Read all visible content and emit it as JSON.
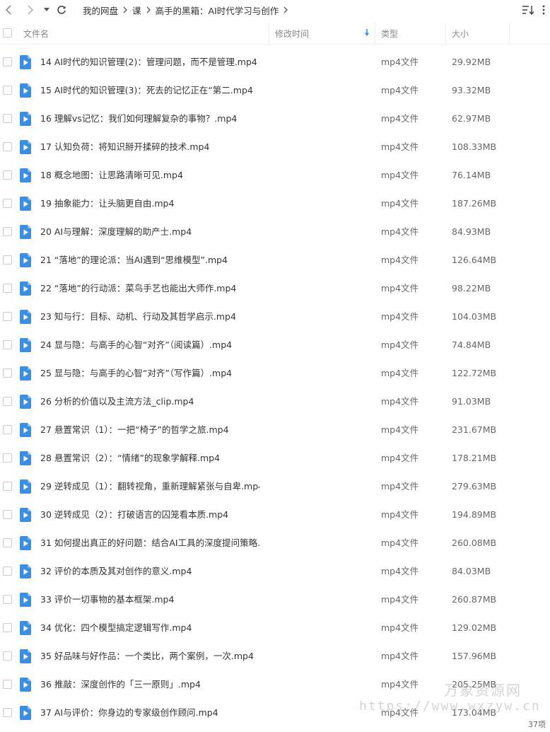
{
  "toolbar": {
    "breadcrumb": [
      "我的网盘",
      "课",
      "高手的黑箱：AI时代学习与创作"
    ]
  },
  "header": {
    "name": "文件名",
    "modified": "修改时间",
    "type": "类型",
    "size": "大小"
  },
  "files": [
    {
      "name": "14 AI时代的知识管理(2)：管理问题，而不是管理.mp4",
      "type": "mp4文件",
      "size": "29.92MB"
    },
    {
      "name": "15 AI时代的知识管理(3)：死去的记忆正在“第二.mp4",
      "type": "mp4文件",
      "size": "93.32MB"
    },
    {
      "name": "16 理解vs记忆：我们如何理解复杂的事物？.mp4",
      "type": "mp4文件",
      "size": "62.97MB"
    },
    {
      "name": "17 认知负荷：将知识掰开揉碎的技术.mp4",
      "type": "mp4文件",
      "size": "108.33MB"
    },
    {
      "name": "18 概念地图：让思路清晰可见.mp4",
      "type": "mp4文件",
      "size": "76.14MB"
    },
    {
      "name": "19 抽象能力：让头脑更自由.mp4",
      "type": "mp4文件",
      "size": "187.26MB"
    },
    {
      "name": "20 AI与理解：深度理解的助产士.mp4",
      "type": "mp4文件",
      "size": "84.93MB"
    },
    {
      "name": "21 “落地”的理论派：当AI遇到“思维模型”.mp4",
      "type": "mp4文件",
      "size": "126.64MB"
    },
    {
      "name": "22 “落地”的行动派：菜鸟手艺也能出大师作.mp4",
      "type": "mp4文件",
      "size": "98.22MB"
    },
    {
      "name": "23 知与行：目标、动机、行动及其哲学启示.mp4",
      "type": "mp4文件",
      "size": "104.03MB"
    },
    {
      "name": "24 显与隐：与高手的心智“对齐”（阅读篇）.mp4",
      "type": "mp4文件",
      "size": "74.84MB"
    },
    {
      "name": "25 显与隐：与高手的心智“对齐”（写作篇）.mp4",
      "type": "mp4文件",
      "size": "122.72MB"
    },
    {
      "name": "26 分析的价值以及主流方法_clip.mp4",
      "type": "mp4文件",
      "size": "91.03MB"
    },
    {
      "name": "27 悬置常识（1）：一把“椅子”的哲学之旅.mp4",
      "type": "mp4文件",
      "size": "231.67MB"
    },
    {
      "name": "28 悬置常识（2）：“情绪”的现象学解释.mp4",
      "type": "mp4文件",
      "size": "178.21MB"
    },
    {
      "name": "29 逆转成见（1）：翻转视角，重新理解紧张与自卑.mp4",
      "type": "mp4文件",
      "size": "279.63MB"
    },
    {
      "name": "30 逆转成见（2）：打破语言的囚笼看本质.mp4",
      "type": "mp4文件",
      "size": "194.89MB"
    },
    {
      "name": "31 如何提出真正的好问题：结合AI工具的深度提问策略....",
      "type": "mp4文件",
      "size": "260.08MB"
    },
    {
      "name": "32 评价的本质及其对创作的意义.mp4",
      "type": "mp4文件",
      "size": "84.03MB"
    },
    {
      "name": "33 评价一切事物的基本框架.mp4",
      "type": "mp4文件",
      "size": "260.87MB"
    },
    {
      "name": "34 优化：四个模型搞定逻辑写作.mp4",
      "type": "mp4文件",
      "size": "129.02MB"
    },
    {
      "name": "35 好品味与好作品：一个类比，两个案例，一次.mp4",
      "type": "mp4文件",
      "size": "157.96MB"
    },
    {
      "name": "36 推敲：深度创作的「三一原则」.mp4",
      "type": "mp4文件",
      "size": "205.25MB"
    },
    {
      "name": "37 AI与评价：你身边的专家级创作顾问.mp4",
      "type": "mp4文件",
      "size": "173.04MB"
    }
  ],
  "watermark": {
    "line1": "万象资源网",
    "line2": "https://www.wxzyw.cn"
  },
  "status": {
    "count": "37项"
  },
  "colors": {
    "file_icon": "#3a8ee6",
    "sort_indicator": "#3a8ee6"
  }
}
